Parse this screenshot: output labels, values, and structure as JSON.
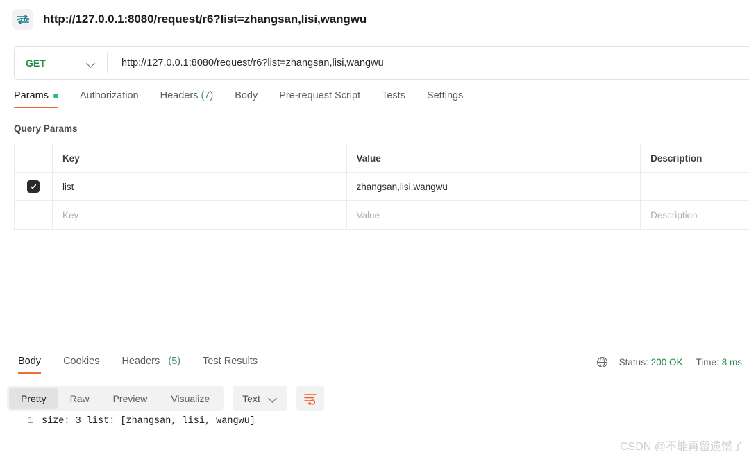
{
  "titlebar": {
    "icon": "http-protocol-icon",
    "title": "http://127.0.0.1:8080/request/r6?list=zhangsan,lisi,wangwu"
  },
  "urlbar": {
    "method": "GET",
    "method_color": "#1c8c42",
    "url": "http://127.0.0.1:8080/request/r6?list=zhangsan,lisi,wangwu"
  },
  "request_tabs": [
    {
      "label": "Params",
      "active": true,
      "dot": true
    },
    {
      "label": "Authorization",
      "active": false
    },
    {
      "label": "Headers",
      "count": "(7)",
      "active": false
    },
    {
      "label": "Body",
      "active": false
    },
    {
      "label": "Pre-request Script",
      "active": false
    },
    {
      "label": "Tests",
      "active": false
    },
    {
      "label": "Settings",
      "active": false
    }
  ],
  "query_params": {
    "section_title": "Query Params",
    "columns": [
      "Key",
      "Value",
      "Description"
    ],
    "rows": [
      {
        "checked": true,
        "key": "list",
        "value": "zhangsan,lisi,wangwu",
        "description": ""
      }
    ],
    "placeholder_row": {
      "key": "Key",
      "value": "Value",
      "description": "Description"
    }
  },
  "response_tabs": [
    {
      "label": "Body",
      "active": true
    },
    {
      "label": "Cookies",
      "active": false
    },
    {
      "label": "Headers",
      "count": "(5)",
      "active": false
    },
    {
      "label": "Test Results",
      "active": false
    }
  ],
  "status": {
    "globe_icon": "globe-icon",
    "status_label": "Status:",
    "status_value": "200 OK",
    "time_label": "Time:",
    "time_value": "8 ms",
    "accent_color": "#1c8c42"
  },
  "body_toolbar": {
    "views": [
      {
        "label": "Pretty",
        "selected": true
      },
      {
        "label": "Raw",
        "selected": false
      },
      {
        "label": "Preview",
        "selected": false
      },
      {
        "label": "Visualize",
        "selected": false
      }
    ],
    "format": "Text",
    "wrap_icon": "word-wrap-icon",
    "wrap_icon_color": "#ef5b25"
  },
  "response_body": {
    "line_number": "1",
    "content": "size: 3 list: [zhangsan, lisi, wangwu]"
  },
  "watermark": "CSDN @不能再留遗憾了"
}
